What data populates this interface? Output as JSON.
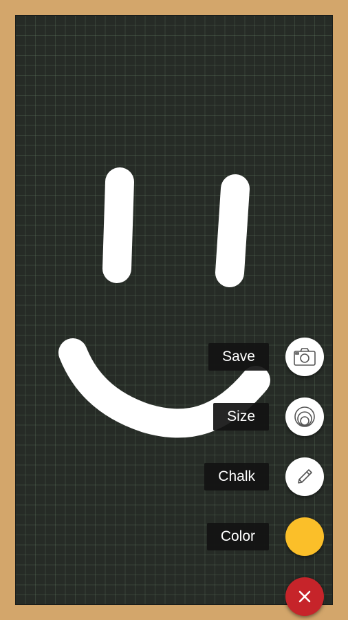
{
  "menu": {
    "items": [
      {
        "id": "save",
        "label": "Save",
        "icon": "camera-icon"
      },
      {
        "id": "size",
        "label": "Size",
        "icon": "size-rings-icon"
      },
      {
        "id": "chalk",
        "label": "Chalk",
        "icon": "pencil-icon"
      },
      {
        "id": "color",
        "label": "Color",
        "icon": "color-swatch-icon"
      }
    ],
    "close_icon": "close-icon"
  },
  "colors": {
    "frame": "#d3a66b",
    "board": "#262b26",
    "chalk": "#ffffff",
    "selected_color": "#fbbf29",
    "close_button": "#c6242a"
  }
}
